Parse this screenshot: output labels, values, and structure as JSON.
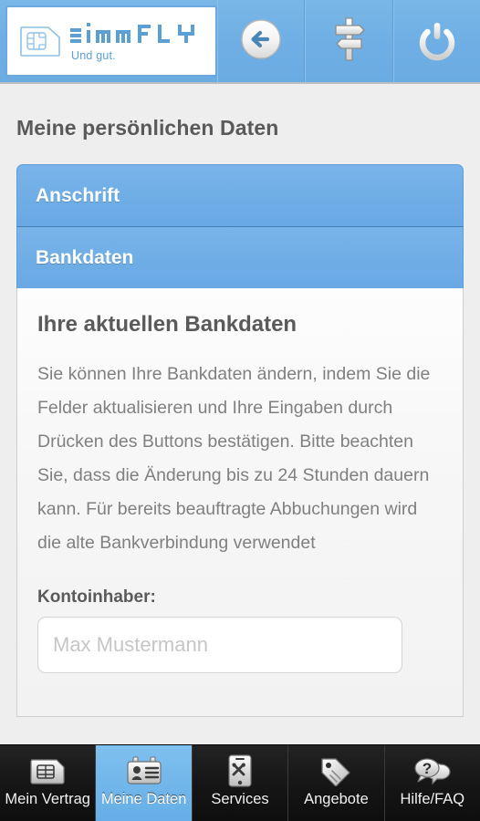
{
  "header": {
    "logo": {
      "icon": "sim-card-icon",
      "wordmark": "simFLY",
      "tagline": "Und gut."
    },
    "buttons": [
      {
        "name": "back-button",
        "icon": "back-arrow-circle-icon"
      },
      {
        "name": "signpost-button",
        "icon": "signpost-icon"
      },
      {
        "name": "power-button",
        "icon": "power-icon"
      }
    ]
  },
  "page": {
    "title": "Meine persönlichen Daten"
  },
  "accordion": {
    "sections": [
      {
        "label": "Anschrift",
        "expanded": false
      },
      {
        "label": "Bankdaten",
        "expanded": true
      }
    ]
  },
  "panel": {
    "title": "Ihre aktuellen Bankdaten",
    "description": "Sie können Ihre Bankdaten ändern, indem Sie die Felder aktualisieren und Ihre Eingaben durch Drücken des Buttons bestätigen. Bitte beachten Sie, dass die Änderung bis zu 24 Stunden dauern kann. Für bereits beauftragte Abbuchungen wird die alte Bankverbindung verwendet",
    "fields": [
      {
        "label": "Kontoinhaber:",
        "value": "",
        "placeholder": "Max Mustermann"
      }
    ]
  },
  "tabbar": {
    "items": [
      {
        "label": "Mein Vertrag",
        "icon": "sim-card-icon",
        "active": false
      },
      {
        "label": "Meine Daten",
        "icon": "id-card-icon",
        "active": true
      },
      {
        "label": "Services",
        "icon": "phone-tools-icon",
        "active": false
      },
      {
        "label": "Angebote",
        "icon": "price-tag-icon",
        "active": false
      },
      {
        "label": "Hilfe/FAQ",
        "icon": "question-chat-icon",
        "active": false
      }
    ]
  },
  "colors": {
    "brand_blue": "#6FAFE4",
    "accent_blue": "#5B9FD4",
    "page_bg": "#EEEEEE",
    "tabbar_bg": "#161616",
    "text_dark": "#5A5A5A",
    "text_muted": "#808080"
  }
}
